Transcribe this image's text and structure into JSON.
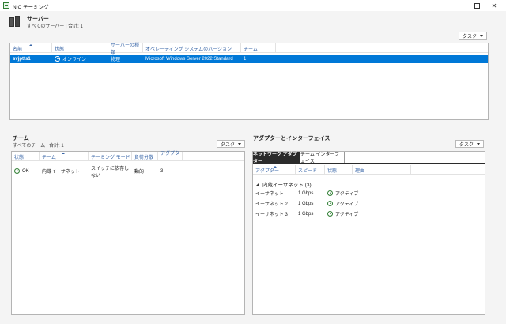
{
  "window": {
    "title": "NIC チーミング"
  },
  "servers": {
    "title": "サーバー",
    "subtitle": "すべてのサーバー | 合計: 1",
    "tasks_label": "タスク",
    "columns": [
      "名前",
      "状態",
      "サーバーの種類",
      "オペレーティング システムのバージョン",
      "チーム"
    ],
    "rows": [
      {
        "name": "svjptfs1",
        "status": "オンライン",
        "type": "物理",
        "os": "Microsoft Windows Server 2022 Standard",
        "teams": "1"
      }
    ]
  },
  "teams": {
    "title": "チーム",
    "subtitle": "すべてのチーム | 合計: 1",
    "tasks_label": "タスク",
    "columns": [
      "状態",
      "チーム",
      "チーミング モード",
      "負荷分散",
      "アダプター"
    ],
    "rows": [
      {
        "status": "OK",
        "team": "内蔵イーサネット",
        "mode": "スイッチに依存しない",
        "lb": "動的",
        "adapters": "3"
      }
    ]
  },
  "adapters": {
    "title": "アダプターとインターフェイス",
    "tasks_label": "タスク",
    "tabs": [
      "ネットワーク アダプター",
      "チーム インターフェイス"
    ],
    "columns": [
      "アダプター",
      "スピード",
      "状態",
      "理由"
    ],
    "group_label": "内蔵イーサネット (3)",
    "rows": [
      {
        "name": "イーサネット",
        "speed": "1 Gbps",
        "status": "アクティブ"
      },
      {
        "name": "イーサネット 2",
        "speed": "1 Gbps",
        "status": "アクティブ"
      },
      {
        "name": "イーサネット 3",
        "speed": "1 Gbps",
        "status": "アクティブ"
      }
    ]
  },
  "colors": {
    "selection": "#0078d7",
    "header_text": "#3a67a8",
    "active_tab": "#2b2b2b",
    "ok_green": "#2e7d32"
  }
}
